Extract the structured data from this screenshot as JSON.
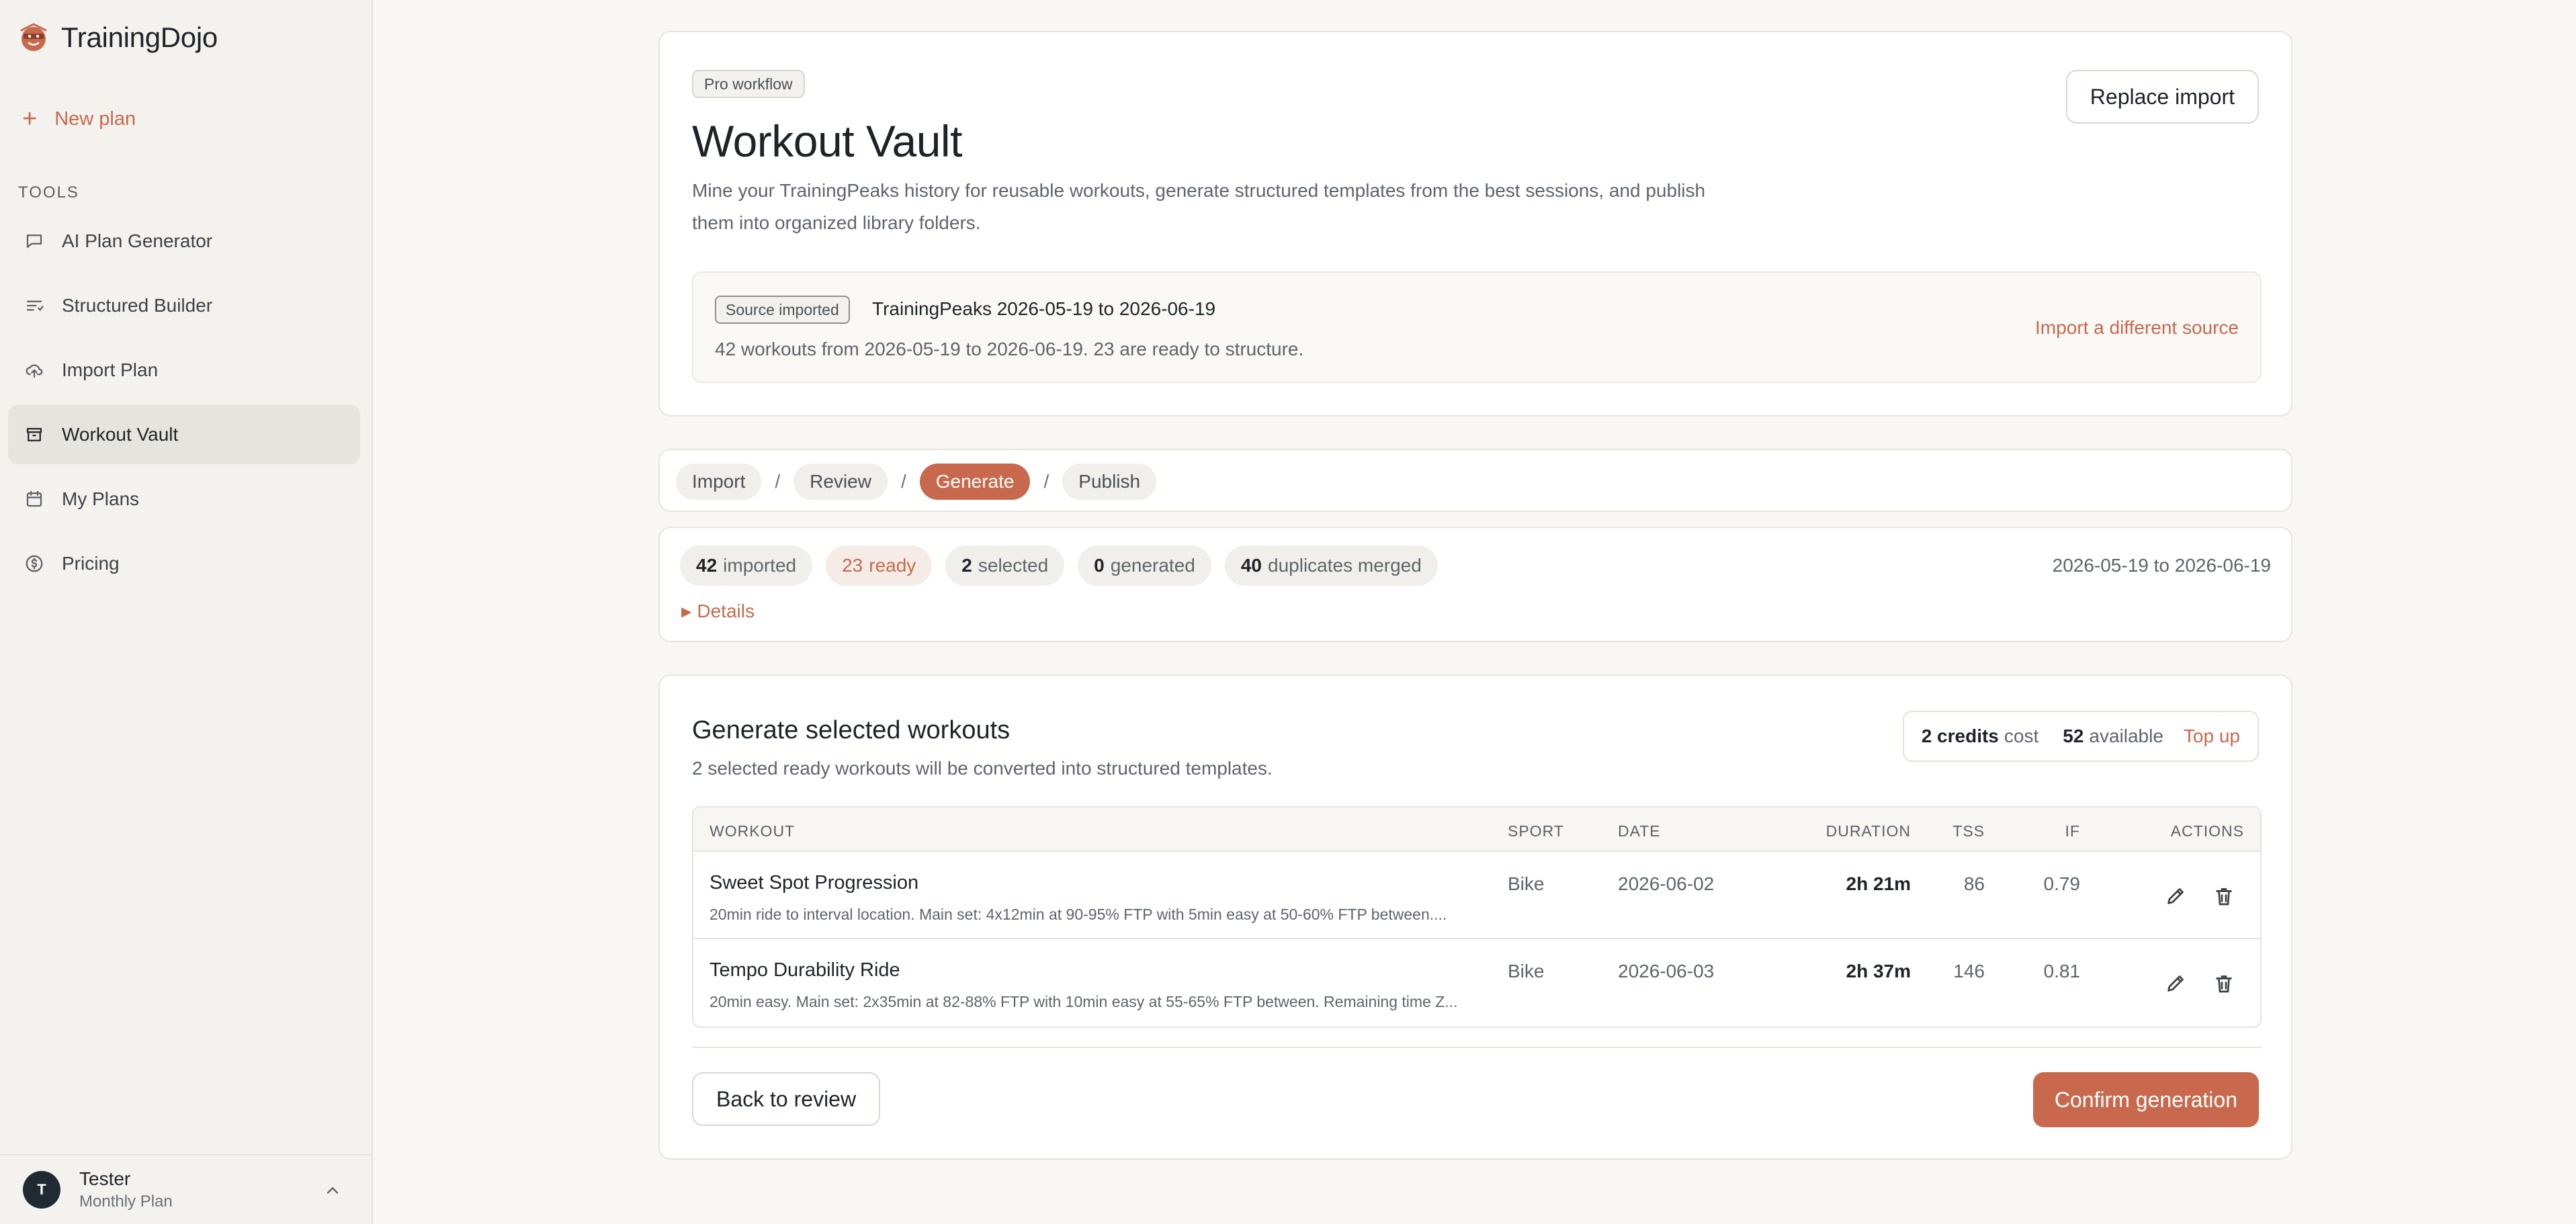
{
  "brand": {
    "name": "TrainingDojo"
  },
  "sidebar": {
    "new_plan": "New plan",
    "section_label": "TOOLS",
    "items": [
      {
        "label": "AI Plan Generator",
        "icon": "chat-icon"
      },
      {
        "label": "Structured Builder",
        "icon": "list-icon"
      },
      {
        "label": "Import Plan",
        "icon": "cloud-upload-icon"
      },
      {
        "label": "Workout Vault",
        "icon": "archive-icon",
        "active": true
      },
      {
        "label": "My Plans",
        "icon": "calendar-icon"
      },
      {
        "label": "Pricing",
        "icon": "dollar-icon"
      }
    ],
    "user": {
      "initial": "T",
      "name": "Tester",
      "plan": "Monthly Plan"
    }
  },
  "header": {
    "badge": "Pro workflow",
    "title": "Workout Vault",
    "description": "Mine your TrainingPeaks history for reusable workouts, generate structured templates from the best sessions, and publish them into organized library folders.",
    "replace_button": "Replace import"
  },
  "source": {
    "badge": "Source imported",
    "title": "TrainingPeaks 2026-05-19 to 2026-06-19",
    "summary": "42 workouts from 2026-05-19 to 2026-06-19. 23 are ready to structure.",
    "link": "Import a different source"
  },
  "steps": [
    {
      "label": "Import"
    },
    {
      "label": "Review"
    },
    {
      "label": "Generate",
      "active": true
    },
    {
      "label": "Publish"
    }
  ],
  "step_separator": "/",
  "stats": {
    "imported": {
      "count": "42",
      "label": "imported"
    },
    "ready": {
      "count": "23",
      "label": "ready"
    },
    "selected": {
      "count": "2",
      "label": "selected"
    },
    "generated": {
      "count": "0",
      "label": "generated"
    },
    "duplicates": {
      "count": "40",
      "label": "duplicates merged"
    },
    "range": "2026-05-19 to 2026-06-19",
    "details": "Details"
  },
  "generate": {
    "title": "Generate selected workouts",
    "subtitle": "2 selected ready workouts will be converted into structured templates.",
    "credits": {
      "cost_value": "2 credits",
      "cost_label": "cost",
      "available_value": "52",
      "available_label": "available",
      "topup": "Top up"
    },
    "columns": {
      "workout": "WORKOUT",
      "sport": "SPORT",
      "date": "DATE",
      "duration": "DURATION",
      "tss": "TSS",
      "if": "IF",
      "actions": "ACTIONS"
    },
    "rows": [
      {
        "name": "Sweet Spot Progression",
        "desc": "20min ride to interval location. Main set: 4x12min at 90-95% FTP with 5min easy at 50-60% FTP between....",
        "sport": "Bike",
        "date": "2026-06-02",
        "duration": "2h 21m",
        "tss": "86",
        "if": "0.79"
      },
      {
        "name": "Tempo Durability Ride",
        "desc": "20min easy. Main set: 2x35min at 82-88% FTP with 10min easy at 55-65% FTP between. Remaining time Z...",
        "sport": "Bike",
        "date": "2026-06-03",
        "duration": "2h 37m",
        "tss": "146",
        "if": "0.81"
      }
    ],
    "back_button": "Back to review",
    "confirm_button": "Confirm generation"
  },
  "colors": {
    "accent": "#c8694d",
    "background": "#f8f7f3",
    "sidebar": "#f3f2ee"
  }
}
